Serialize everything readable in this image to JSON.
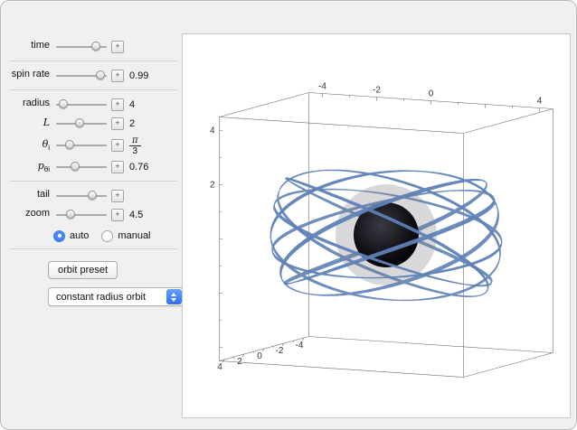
{
  "controls": {
    "plus_label": "+",
    "sliders": [
      {
        "label": "time",
        "sub": "",
        "value": "",
        "pct": 78
      },
      {
        "label": "spin rate",
        "sub": "",
        "value": "0.99",
        "pct": 88
      },
      {
        "label": "radius",
        "sub": "",
        "value": "4",
        "pct": 15
      },
      {
        "label": "L",
        "sub": "",
        "value": "2",
        "pct": 47
      },
      {
        "label": "θ",
        "sub": "i",
        "value": "",
        "frac": {
          "num": "π",
          "den": "3"
        },
        "pct": 26
      },
      {
        "label": "p",
        "sub": "θi",
        "value": "0.76",
        "pct": 38
      },
      {
        "label": "tail",
        "sub": "",
        "value": "",
        "pct": 72
      },
      {
        "label": "zoom",
        "sub": "",
        "value": "4.5",
        "pct": 28
      }
    ],
    "radio": {
      "options": [
        "auto",
        "manual"
      ],
      "selected": "auto",
      "accent": "#2e6ef0"
    },
    "preset_button": "orbit preset",
    "dropdown": {
      "value": "constant radius orbit"
    }
  },
  "plot": {
    "axes": {
      "top": [
        {
          "v": -4,
          "l": "-4"
        },
        {
          "v": -2,
          "l": "-2"
        },
        {
          "v": 0,
          "l": "0"
        },
        {
          "v": 2,
          "l": ""
        },
        {
          "v": 4,
          "l": "4"
        }
      ],
      "left": [
        {
          "v": 4,
          "l": "4"
        },
        {
          "v": 2,
          "l": "2"
        },
        {
          "v": 0,
          "l": ""
        },
        {
          "v": -2,
          "l": ""
        },
        {
          "v": -4,
          "l": ""
        }
      ],
      "bottom": [
        {
          "v": 4,
          "l": "4"
        },
        {
          "v": 2,
          "l": "2"
        },
        {
          "v": 0,
          "l": "0"
        },
        {
          "v": -2,
          "l": "-2"
        },
        {
          "v": -4,
          "l": "-4"
        }
      ]
    },
    "orbit": {
      "radius": 4,
      "theta_amplitude": 0.5236,
      "color": "#5e81b5"
    },
    "colors": {
      "edge": "#6e6e6e",
      "tick_text": "#333333",
      "gray_sphere": "rgba(125,125,132,0.30)",
      "black_hole": "#0a0a0f"
    }
  }
}
